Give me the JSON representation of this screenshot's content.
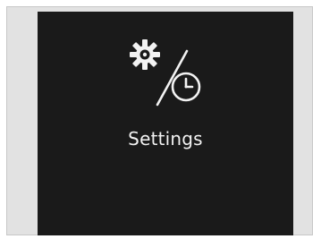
{
  "screen": {
    "title": "Settings",
    "icon_gear": "gear-icon",
    "icon_clock": "clock-icon",
    "colors": {
      "background": "#1a1a1a",
      "foreground": "#f2f2f2",
      "frame": "#e2e2e2"
    }
  }
}
